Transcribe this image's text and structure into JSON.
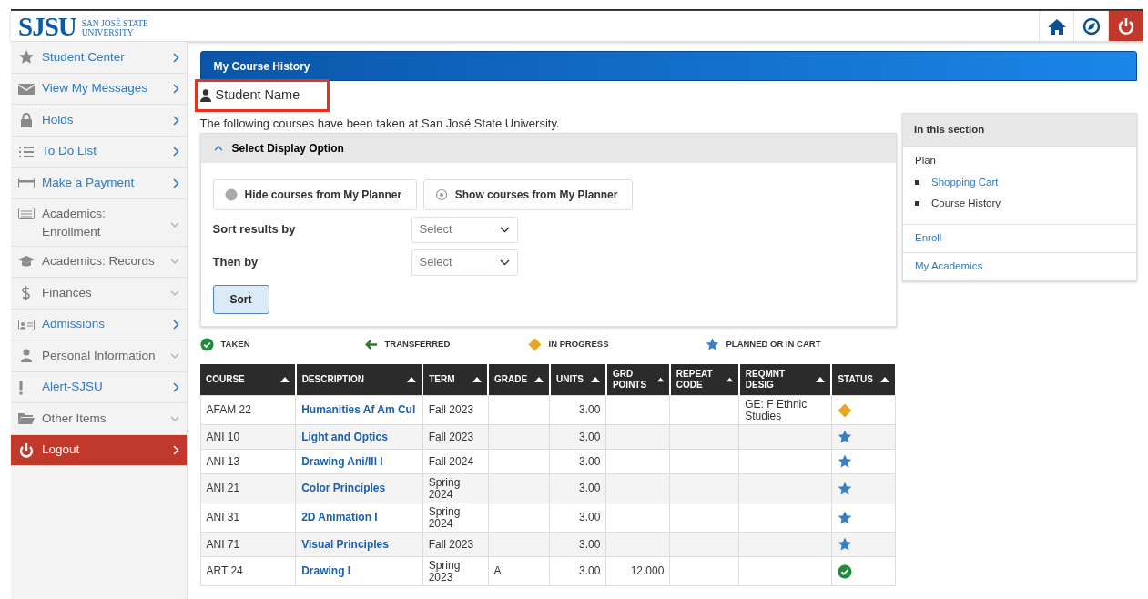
{
  "header": {
    "logo": "SJSU",
    "logo_subtitle_1": "SAN JOSÉ STATE",
    "logo_subtitle_2": "UNIVERSITY"
  },
  "sidebar": {
    "items": [
      {
        "label": "Student Center",
        "kind": "link"
      },
      {
        "label": "View My Messages",
        "kind": "link"
      },
      {
        "label": "Holds",
        "kind": "link"
      },
      {
        "label": "To Do List",
        "kind": "link"
      },
      {
        "label": "Make a Payment",
        "kind": "link"
      },
      {
        "label": "Academics: Enrollment",
        "kind": "expand"
      },
      {
        "label": "Academics: Records",
        "kind": "expand"
      },
      {
        "label": "Finances",
        "kind": "expand"
      },
      {
        "label": "Admissions",
        "kind": "link"
      },
      {
        "label": "Personal Information",
        "kind": "expand"
      },
      {
        "label": "Alert-SJSU",
        "kind": "link"
      },
      {
        "label": "Other Items",
        "kind": "expand"
      },
      {
        "label": "Logout",
        "kind": "logout"
      }
    ]
  },
  "page_title": "My Course History",
  "student": {
    "name": "Student Name",
    "highlighted": true
  },
  "intro": "The following courses have been taken at San José State University.",
  "display_options": {
    "title": "Select Display Option",
    "expanded": true,
    "radios": [
      {
        "label": "Hide courses from My Planner",
        "selected": true
      },
      {
        "label": "Show courses from My Planner",
        "selected": false
      }
    ],
    "sorts": [
      {
        "label": "Sort results by",
        "placeholder": "Select"
      },
      {
        "label": "Then by",
        "placeholder": "Select"
      }
    ],
    "button": "Sort"
  },
  "legend": [
    {
      "kind": "taken",
      "label": "TAKEN"
    },
    {
      "kind": "transferred",
      "label": "TRANSFERRED"
    },
    {
      "kind": "in_progress",
      "label": "IN PROGRESS"
    },
    {
      "kind": "planned",
      "label": "PLANNED OR IN CART"
    }
  ],
  "table": {
    "columns": [
      "COURSE",
      "DESCRIPTION",
      "TERM",
      "GRADE",
      "UNITS",
      "GRD POINTS",
      "REPEAT CODE",
      "REQMNT DESIG",
      "STATUS"
    ],
    "rows": [
      {
        "course": "AFAM 22",
        "description": "Humanities Af Am Cul",
        "term": "Fall 2023",
        "units": "3.00",
        "reqmnt_desig": "GE: F Ethnic Studies",
        "kind": "in_progress"
      },
      {
        "course": "ANI 10",
        "description": "Light and Optics",
        "term": "Fall 2023",
        "units": "3.00",
        "kind": "planned"
      },
      {
        "course": "ANI 13",
        "description": "Drawing Ani/Ill I",
        "term": "Fall 2024",
        "units": "3.00",
        "kind": "planned"
      },
      {
        "course": "ANI 21",
        "description": "Color Principles",
        "term": "Spring 2024",
        "units": "3.00",
        "kind": "planned"
      },
      {
        "course": "ANI 31",
        "description": "2D Animation I",
        "term": "Spring 2024",
        "units": "3.00",
        "kind": "planned"
      },
      {
        "course": "ANI 71",
        "description": "Visual Principles",
        "term": "Fall 2023",
        "units": "3.00",
        "kind": "planned"
      },
      {
        "course": "ART 24",
        "description": "Drawing I",
        "term": "Spring 2023",
        "grade": "A",
        "units": "3.00",
        "grd_points": "12.000",
        "kind": "taken"
      }
    ]
  },
  "in_this_section": {
    "title": "In this section",
    "group": "Plan",
    "items": [
      {
        "label": "Shopping Cart",
        "kind": "link"
      },
      {
        "label": "Course History",
        "kind": "current"
      }
    ],
    "links": [
      "Enroll",
      "My Academics"
    ]
  }
}
